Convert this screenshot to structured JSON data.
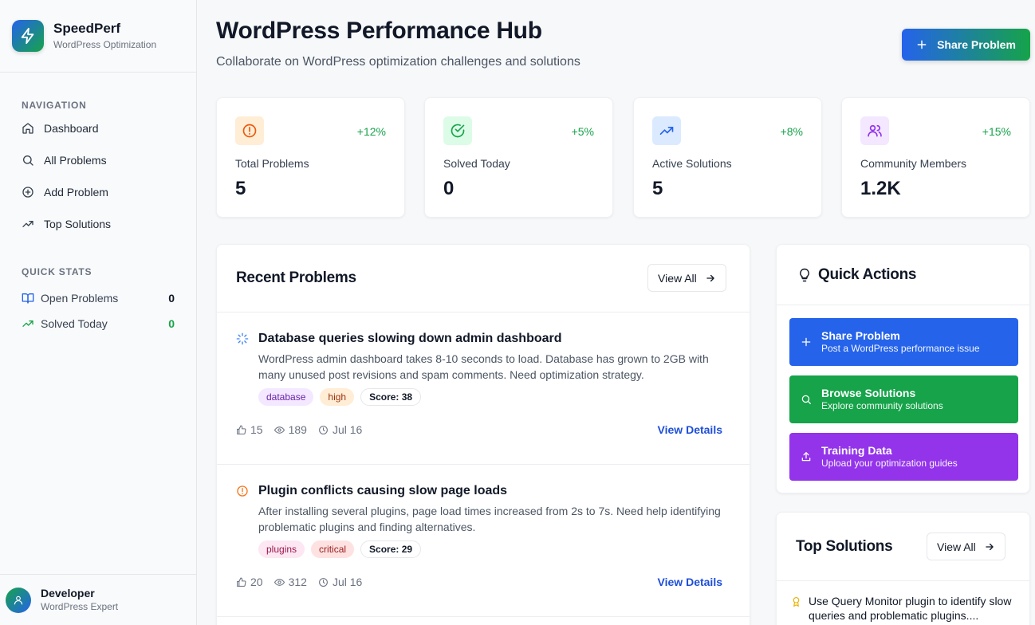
{
  "brand": {
    "name": "SpeedPerf",
    "subtitle": "WordPress Optimization"
  },
  "sidebar": {
    "nav_title": "NAVIGATION",
    "items": [
      {
        "label": "Dashboard",
        "icon": "home-icon"
      },
      {
        "label": "All Problems",
        "icon": "search-icon"
      },
      {
        "label": "Add Problem",
        "icon": "plus-circle-icon"
      },
      {
        "label": "Top Solutions",
        "icon": "trending-up-icon"
      }
    ],
    "stats_title": "QUICK STATS",
    "stats": [
      {
        "label": "Open Problems",
        "value": "0",
        "icon": "book-open-icon"
      },
      {
        "label": "Solved Today",
        "value": "0",
        "icon": "trending-up-icon"
      }
    ]
  },
  "user": {
    "name": "Developer",
    "role": "WordPress Expert"
  },
  "header": {
    "title": "WordPress Performance Hub",
    "subtitle": "Collaborate on WordPress optimization challenges and solutions",
    "share_label": "Share Problem"
  },
  "stats": [
    {
      "label": "Total Problems",
      "value": "5",
      "change": "+12%",
      "icon": "alert-circle-icon",
      "color": "#ea580c"
    },
    {
      "label": "Solved Today",
      "value": "0",
      "change": "+5%",
      "icon": "check-circle-icon",
      "color": "#16a34a"
    },
    {
      "label": "Active Solutions",
      "value": "5",
      "change": "+8%",
      "icon": "trending-up-icon",
      "color": "#2563eb"
    },
    {
      "label": "Community Members",
      "value": "1.2K",
      "change": "+15%",
      "icon": "users-icon",
      "color": "#9333ea"
    }
  ],
  "recent": {
    "title": "Recent Problems",
    "view_all": "View All",
    "problems": [
      {
        "title": "Database queries slowing down admin dashboard",
        "description": "WordPress admin dashboard takes 8-10 seconds to load. Database has grown to 2GB with many unused post revisions and spam comments. Need optimization strategy.",
        "tags": [
          "database",
          "high"
        ],
        "score": "Score: 38",
        "likes": "15",
        "views": "189",
        "date": "Jul 16",
        "status_icon": "loader-icon",
        "details_label": "View Details"
      },
      {
        "title": "Plugin conflicts causing slow page loads",
        "description": "After installing several plugins, page load times increased from 2s to 7s. Need help identifying problematic plugins and finding alternatives.",
        "tags": [
          "plugins",
          "critical"
        ],
        "score": "Score: 29",
        "likes": "20",
        "views": "312",
        "date": "Jul 16",
        "status_icon": "alert-circle-icon",
        "details_label": "View Details"
      }
    ]
  },
  "quick_actions": {
    "title": "Quick Actions",
    "items": [
      {
        "title": "Share Problem",
        "subtitle": "Post a WordPress performance issue",
        "color": "#2563eb",
        "icon": "plus-icon"
      },
      {
        "title": "Browse Solutions",
        "subtitle": "Explore community solutions",
        "color": "#16a34a",
        "icon": "search-icon"
      },
      {
        "title": "Training Data",
        "subtitle": "Upload your optimization guides",
        "color": "#9333ea",
        "icon": "upload-icon"
      }
    ]
  },
  "top_solutions": {
    "title": "Top Solutions",
    "view_all": "View All",
    "items": [
      {
        "text": "Use Query Monitor plugin to identify slow queries and problematic plugins....",
        "icon": "award-icon"
      }
    ]
  }
}
